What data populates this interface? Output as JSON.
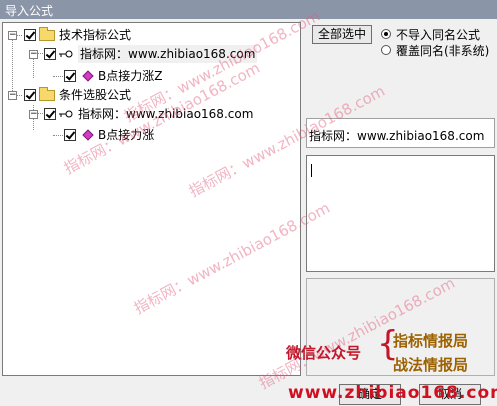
{
  "window": {
    "title": "导入公式"
  },
  "tree": {
    "group1": {
      "label": "技术指标公式",
      "child": {
        "label": "指标网：www.zhibiao168.com"
      },
      "leaf": {
        "label": "B点接力涨Z"
      }
    },
    "group2": {
      "label": "条件选股公式",
      "child": {
        "label": "指标网：www.zhibiao168.com"
      },
      "leaf": {
        "label": "B点接力涨"
      }
    }
  },
  "controls": {
    "select_all_label": "全部选中",
    "option_skip_label": "不导入同名公式",
    "option_overwrite_label": "覆盖同名(非系统)",
    "selected_option": "不导入同名公式"
  },
  "info": {
    "source_label": "指标网：www.zhibiao168.com"
  },
  "footer": {
    "ok_label": "确定",
    "cancel_label": "取消"
  },
  "watermarks": {
    "wm1": "指标网：www.zhibiao168.com",
    "wm2": "指标网：www.zhibiao168.com",
    "wm3": "指标网：www.zhibiao168.com",
    "wm4": "指标网：www.zhibiao168.com",
    "wm5": "指标网：www.zhibiao168.com"
  },
  "promo": {
    "wechat": "微信公众号",
    "line1": "指标情报局",
    "line2": "战法情报局",
    "url": "www.zhibiao168.com"
  },
  "colors": {
    "titlebar": "#8a96a8",
    "diamond": "#d33cc5",
    "promo_red": "#c4162a",
    "promo_gold": "#9c6200"
  }
}
